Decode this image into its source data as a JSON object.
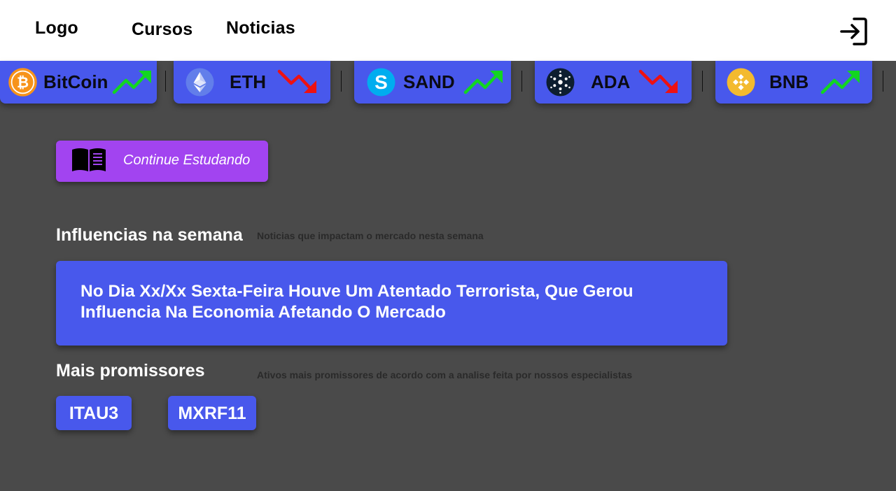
{
  "nav": {
    "logo": "Logo",
    "items": [
      "Cursos",
      "Noticias"
    ],
    "login_icon": "login-icon"
  },
  "tickers": [
    {
      "name": "BitCoin",
      "icon": "bitcoin-icon",
      "trend": "up",
      "trend_color": "#12d621"
    },
    {
      "name": "ETH",
      "icon": "ethereum-icon",
      "trend": "down",
      "trend_color": "#ee1111"
    },
    {
      "name": "SAND",
      "icon": "sandbox-icon",
      "trend": "up",
      "trend_color": "#12d621"
    },
    {
      "name": "ADA",
      "icon": "cardano-icon",
      "trend": "down",
      "trend_color": "#ee1111"
    },
    {
      "name": "BNB",
      "icon": "binance-icon",
      "trend": "up",
      "trend_color": "#12d621"
    }
  ],
  "continue": {
    "label": "Continue Estudando",
    "icon": "book-icon"
  },
  "influences": {
    "title": "Influencias na semana",
    "subtitle": "Noticias que impactam o mercado nesta semana",
    "news": "No Dia Xx/Xx Sexta-Feira Houve Um Atentado Terrorista, Que Gerou Influencia Na Economia Afetando O Mercado"
  },
  "promising": {
    "title": "Mais promissores",
    "subtitle": "Ativos mais promissores de acordo com a analise feita por nossos especialistas",
    "assets": [
      "ITAU3",
      "MXRF11"
    ]
  },
  "colors": {
    "background": "#4a4a4a",
    "card": "#4858ec",
    "accent_purple": "#a244f0",
    "trend_up": "#12d621",
    "trend_down": "#ee1111"
  }
}
